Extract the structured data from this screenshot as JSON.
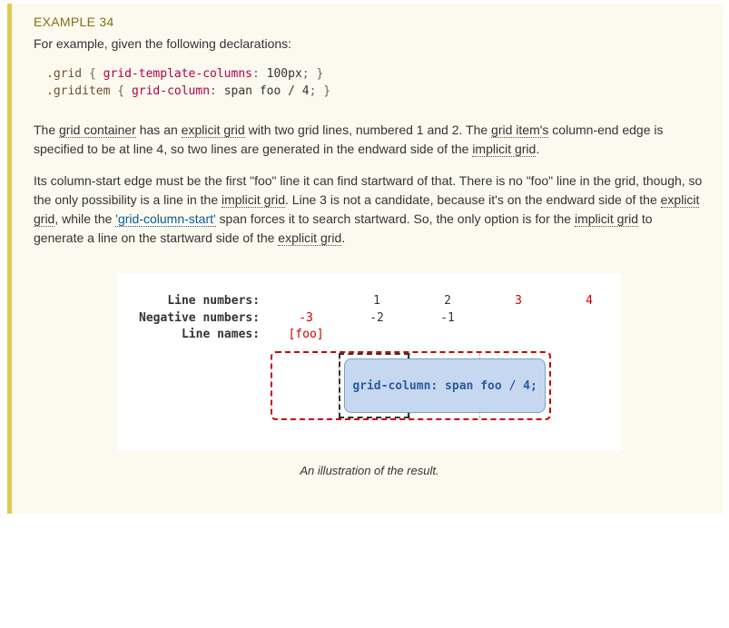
{
  "example": {
    "label": "EXAMPLE 34",
    "intro": "For example, given the following declarations:"
  },
  "code": {
    "sel1": ".grid",
    "prop1": "grid-template-columns",
    "val1": "100px",
    "sel2": ".griditem",
    "prop2": "grid-column",
    "val2": "span foo / 4"
  },
  "para1": {
    "t0": "The ",
    "l0": "grid container",
    "t1": " has an ",
    "l1": "explicit grid",
    "t2": " with two grid lines, numbered 1 and 2. The ",
    "l2": "grid item's",
    "t3": " column-end edge is specified to be at line 4, so two lines are generated in the endward side of the ",
    "l3": "implicit grid",
    "t4": "."
  },
  "para2": {
    "t0": "Its column-start edge must be the first \"foo\" line it can find startward of that. There is no \"foo\" line in the grid, though, so the only possibility is a line in the ",
    "l0": "implicit grid",
    "t1": ". Line 3 is not a candidate, because it's on the endward side of the ",
    "l1": "explicit grid",
    "t2": ", while the ",
    "pl": "'grid-column-start'",
    "t3": " span forces it to search startward. So, the only option is for the ",
    "l2": "implicit grid",
    "t4": " to generate a line on the startward side of the ",
    "l3": "explicit grid",
    "t5": "."
  },
  "figure": {
    "row_labels": {
      "line_numbers": "Line numbers:",
      "neg_numbers": "Negative numbers:",
      "line_names": "Line names:"
    },
    "lines": {
      "c0": "",
      "c1": "1",
      "c2": "2",
      "c3": "3",
      "c4": "4"
    },
    "neg": {
      "c0": "-3",
      "c1": "-2",
      "c2": "-1",
      "c3": "",
      "c4": ""
    },
    "names": {
      "c0": "[foo]"
    },
    "item_label": "grid-column: span foo / 4;",
    "caption": "An illustration of the result."
  }
}
